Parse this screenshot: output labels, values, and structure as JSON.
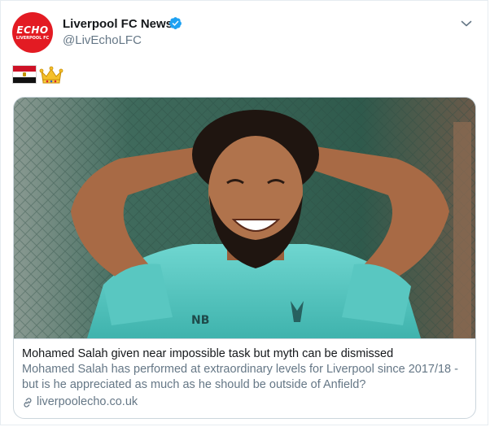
{
  "author": {
    "name": "Liverpool FC News",
    "handle": "@LivEchoLFC",
    "avatar_text": "ECHO",
    "avatar_subtext": "LIVERPOOL FC",
    "verified": true
  },
  "tweet": {
    "emojis": [
      "egypt-flag",
      "crown"
    ]
  },
  "card": {
    "title": "Mohamed Salah given near impossible task but myth can be dismissed",
    "description": "Mohamed Salah has performed at extraordinary levels for Liverpool since 2017/18 - but is he appreciated as much as he should be outside of Anfield?",
    "domain": "liverpoolecho.co.uk",
    "image_subject": "footballer-smiling-hands-on-head"
  },
  "colors": {
    "verified_blue": "#1da1f2",
    "avatar_red": "#e31b23",
    "secondary_text": "#657786",
    "border": "#ccd6dd"
  }
}
